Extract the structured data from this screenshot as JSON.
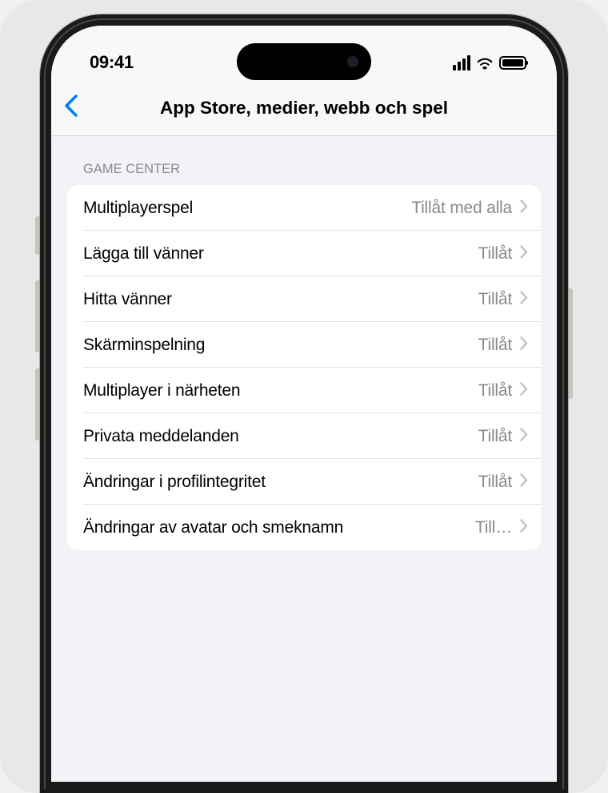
{
  "statusBar": {
    "time": "09:41"
  },
  "navBar": {
    "title": "App Store, medier, webb och spel"
  },
  "section": {
    "header": "GAME CENTER",
    "rows": [
      {
        "label": "Multiplayerspel",
        "value": "Tillåt med alla"
      },
      {
        "label": "Lägga till vänner",
        "value": "Tillåt"
      },
      {
        "label": "Hitta vänner",
        "value": "Tillåt"
      },
      {
        "label": "Skärminspelning",
        "value": "Tillåt"
      },
      {
        "label": "Multiplayer i närheten",
        "value": "Tillåt"
      },
      {
        "label": "Privata meddelanden",
        "value": "Tillåt"
      },
      {
        "label": "Ändringar i profilintegritet",
        "value": "Tillåt"
      },
      {
        "label": "Ändringar av avatar och smeknamn",
        "value": "Till…"
      }
    ]
  }
}
